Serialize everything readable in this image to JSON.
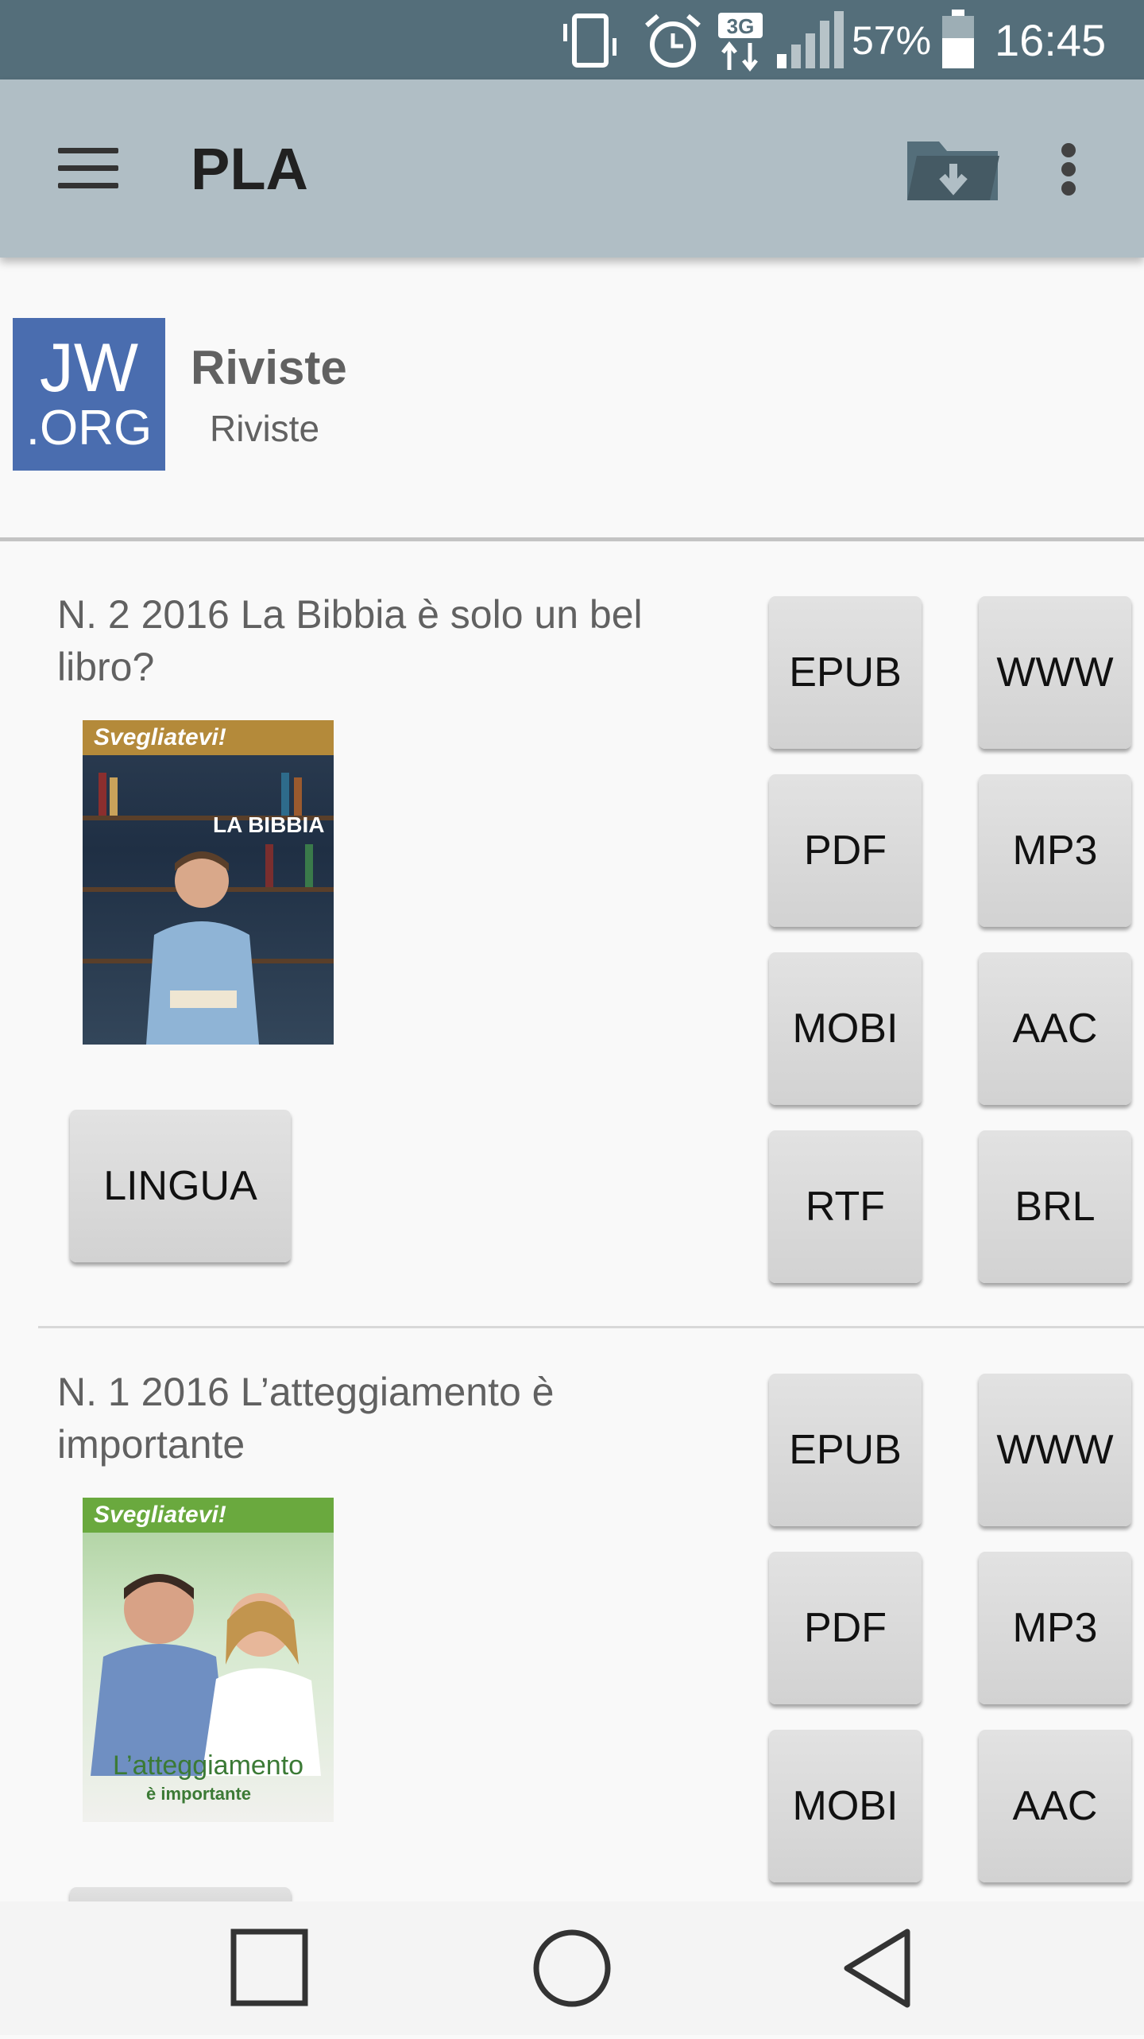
{
  "status_bar": {
    "network": "3G",
    "battery": "57%",
    "time": "16:45",
    "icons": [
      "vibrate-icon",
      "alarm-icon",
      "network-3g-icon",
      "signal-icon",
      "battery-icon"
    ]
  },
  "app_bar": {
    "title": "PLA",
    "icons": [
      "menu-icon",
      "download-folder-icon",
      "overflow-menu-icon"
    ]
  },
  "header": {
    "logo_line1": "JW",
    "logo_line2": ".ORG",
    "title": "Riviste",
    "subtitle": "Riviste"
  },
  "items": [
    {
      "title": "N. 2 2016 La Bibbia è solo un bel libro?",
      "cover_masthead": "Svegliatevi!",
      "cover_caption": "LA BIBBIA",
      "formats": [
        "EPUB",
        "WWW",
        "PDF",
        "MP3",
        "MOBI",
        "AAC",
        "RTF",
        "BRL"
      ],
      "language_label": "LINGUA"
    },
    {
      "title": "N. 1 2016 L’atteggiamento è importante",
      "cover_masthead": "Svegliatevi!",
      "cover_caption": "L’atteggiamento",
      "cover_caption_sub": "è importante",
      "formats": [
        "EPUB",
        "WWW",
        "PDF",
        "MP3",
        "MOBI",
        "AAC"
      ]
    }
  ],
  "nav_bar": {
    "icons": [
      "recent-apps-icon",
      "home-icon",
      "back-icon"
    ]
  },
  "colors": {
    "status_bar": "#546e7a",
    "app_bar": "#b0bec5",
    "logo": "#4a6daf",
    "button": "#d9d9d9"
  }
}
